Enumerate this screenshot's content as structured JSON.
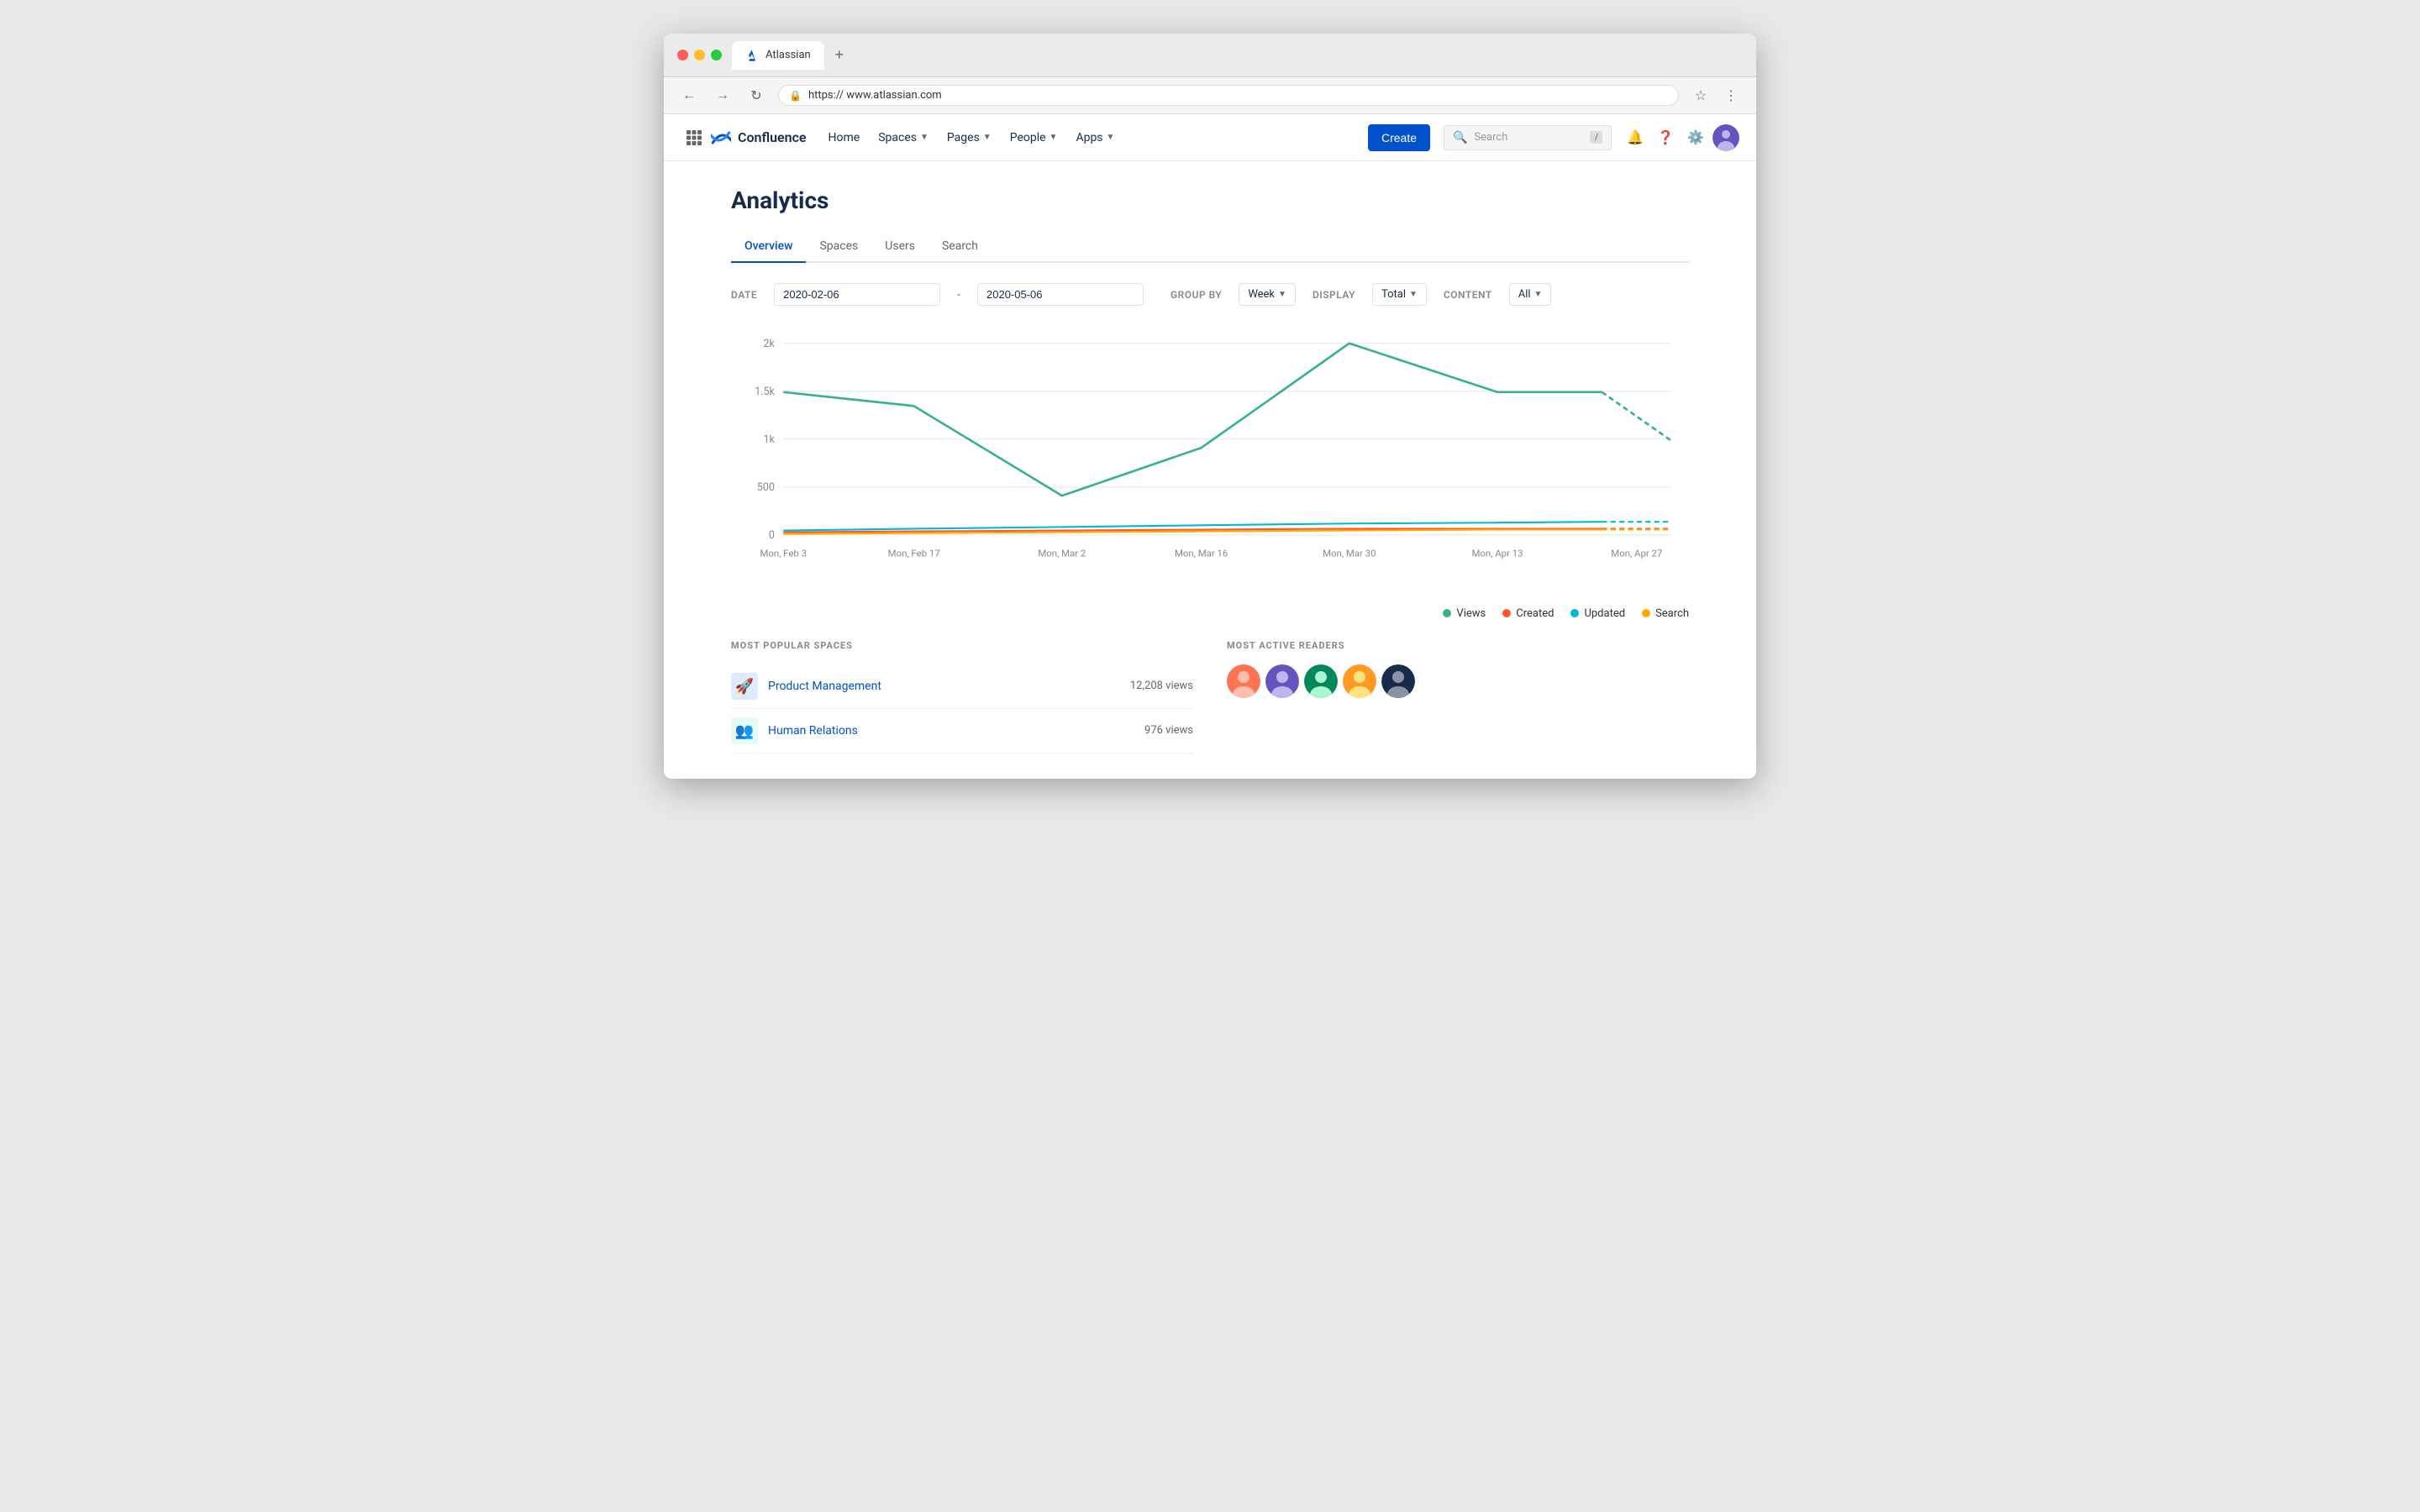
{
  "browser": {
    "tab_title": "Atlassian",
    "tab_icon": "atlassian-icon",
    "url": "https:// www.atlassian.com",
    "new_tab_label": "+"
  },
  "nav": {
    "apps_icon": "⋮⋮⋮",
    "logo_text": "Confluence",
    "menu_items": [
      {
        "label": "Home",
        "has_dropdown": false
      },
      {
        "label": "Spaces",
        "has_dropdown": true
      },
      {
        "label": "Pages",
        "has_dropdown": true
      },
      {
        "label": "People",
        "has_dropdown": true
      },
      {
        "label": "Apps",
        "has_dropdown": true
      }
    ],
    "create_label": "Create",
    "search_placeholder": "Search",
    "search_shortcut": "/"
  },
  "page": {
    "title": "Analytics"
  },
  "tabs": [
    {
      "label": "Overview",
      "active": true
    },
    {
      "label": "Spaces",
      "active": false
    },
    {
      "label": "Users",
      "active": false
    },
    {
      "label": "Search",
      "active": false
    }
  ],
  "filters": {
    "date_label": "DATE",
    "date_from": "2020-02-06",
    "date_to": "2020-05-06",
    "group_by_label": "GROUP BY",
    "group_by_value": "Week",
    "display_label": "DISPLAY",
    "display_value": "Total",
    "content_label": "CONTENT",
    "content_value": "All"
  },
  "chart": {
    "y_labels": [
      "2k",
      "1.5k",
      "1k",
      "500",
      "0"
    ],
    "x_labels": [
      "Mon, Feb 3",
      "Mon, Feb 17",
      "Mon, Mar 2",
      "Mon, Mar 16",
      "Mon, Mar 30",
      "Mon, Apr 13",
      "Mon, Apr 27"
    ],
    "colors": {
      "views": "#36b37e",
      "created": "#ff5630",
      "updated": "#00b8d9",
      "search": "#ffab00"
    }
  },
  "legend": {
    "items": [
      {
        "label": "Views",
        "color": "#36b37e"
      },
      {
        "label": "Created",
        "color": "#ff5630"
      },
      {
        "label": "Updated",
        "color": "#00b8d9"
      },
      {
        "label": "Search",
        "color": "#ffab00"
      }
    ]
  },
  "most_popular": {
    "title": "MOST POPULAR SPACES",
    "spaces": [
      {
        "name": "Product Management",
        "views": "12,208 views"
      },
      {
        "name": "Human Relations",
        "views": "976 views"
      }
    ]
  },
  "most_active": {
    "title": "MOST ACTIVE READERS"
  }
}
